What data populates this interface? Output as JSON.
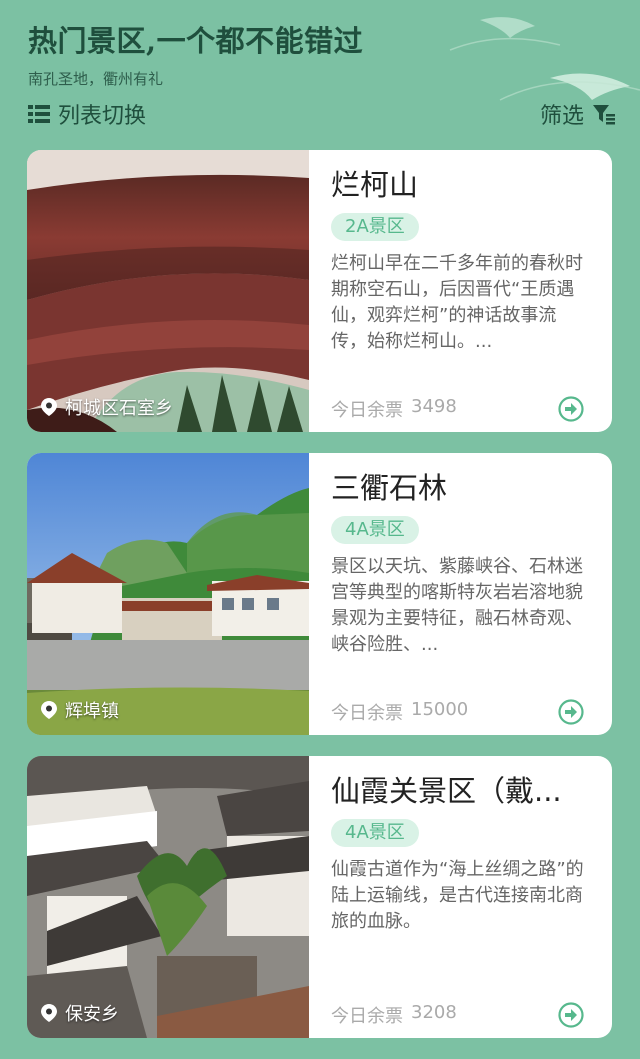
{
  "header": {
    "title": "热门景区,一个都不能错过",
    "subtitle": "南孔圣地，衢州有礼"
  },
  "toolbar": {
    "toggle_icon": "list-icon",
    "toggle_label": "列表切换",
    "filter_label": "筛选",
    "filter_icon": "filter-icon"
  },
  "cards": [
    {
      "name": "烂柯山",
      "level": "2A景区",
      "description": "烂柯山早在二千多年前的春秋时期称空石山，后因晋代“王质遇仙，观弈烂柯”的神话故事流传，始称烂柯山。...",
      "location": "柯城区石室乡",
      "tickets_label": "今日余票",
      "tickets": "3498"
    },
    {
      "name": "三衢石林",
      "level": "4A景区",
      "description": "景区以天坑、紫藤峡谷、石林迷宫等典型的喀斯特灰岩岩溶地貌景观为主要特征，融石林奇观、峡谷险胜、...",
      "location": "辉埠镇",
      "tickets_label": "今日余票",
      "tickets": "15000"
    },
    {
      "name": "仙霞关景区（戴...",
      "level": "4A景区",
      "description": "仙霞古道作为“海上丝绸之路”的陆上运输线，是古代连接南北商旅的血脉。",
      "location": "保安乡",
      "tickets_label": "今日余票",
      "tickets": "3208"
    }
  ],
  "colors": {
    "background": "#7cc1a3",
    "accent": "#57b88d",
    "badge_bg": "#d9f2e6",
    "title": "#1f4f3d"
  }
}
